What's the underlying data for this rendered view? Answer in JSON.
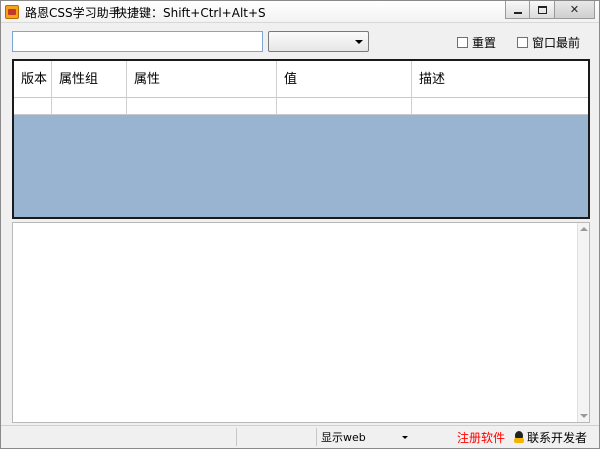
{
  "window": {
    "title": "路恩CSS学习助手",
    "hotkey": "快捷键：Shift+Ctrl+Alt+S"
  },
  "toolbar": {
    "search_value": "",
    "select_value": "",
    "reset_label": "重置",
    "topmost_label": "窗口最前"
  },
  "grid": {
    "columns": [
      "版本",
      "属性组",
      "属性",
      "值",
      "描述"
    ],
    "rows": [
      [
        "",
        "",
        "",
        "",
        ""
      ]
    ]
  },
  "textarea": {
    "value": ""
  },
  "statusbar": {
    "display_select": "显示web",
    "register_label": "注册软件",
    "contact_label": "联系开发者"
  },
  "colors": {
    "grid_background": "#99b4d1",
    "register_text": "#ff0000",
    "input_border": "#7aa7d8"
  },
  "icons": {
    "app": "app-logo-icon",
    "contact": "qq-penguin-icon"
  }
}
